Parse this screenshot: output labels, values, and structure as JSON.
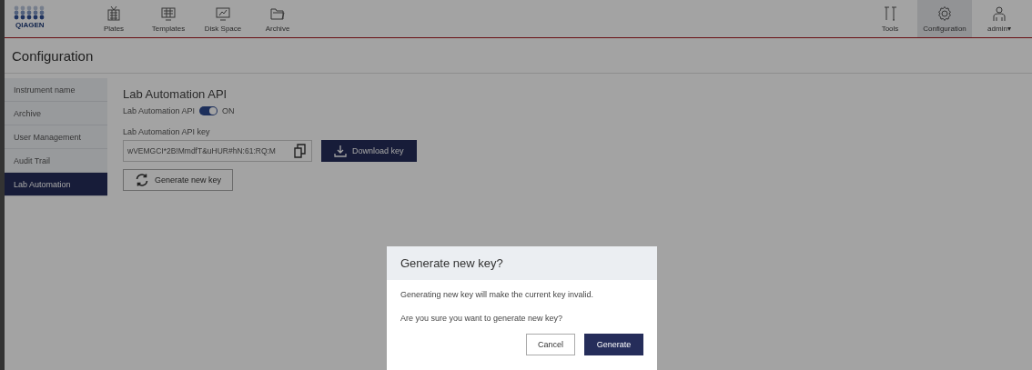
{
  "logo": {
    "text": "QIAGEN"
  },
  "nav": {
    "items": [
      {
        "label": "Plates",
        "selected": false
      },
      {
        "label": "Templates",
        "selected": false
      },
      {
        "label": "Disk Space",
        "selected": false
      },
      {
        "label": "Archive",
        "selected": false
      }
    ],
    "right_items": [
      {
        "label": "Tools",
        "selected": false
      },
      {
        "label": "Configuration",
        "selected": true
      },
      {
        "label": "admin",
        "selected": false,
        "caret": "▾"
      }
    ]
  },
  "page_title": "Configuration",
  "sidebar": {
    "items": [
      {
        "label": "Instrument name",
        "selected": false
      },
      {
        "label": "Archive",
        "selected": false
      },
      {
        "label": "User Management",
        "selected": false
      },
      {
        "label": "Audit Trail",
        "selected": false
      },
      {
        "label": "Lab Automation",
        "selected": true
      }
    ]
  },
  "section": {
    "title": "Lab Automation API",
    "toggle": {
      "label": "Lab Automation API",
      "on": true,
      "state_text": "ON"
    },
    "key_label": "Lab Automation API key",
    "key_value": "wVEMGCI*2B!MmdfT&uHUR#hN:61:RQ:M",
    "download_button": "Download key",
    "generate_button": "Generate new key"
  },
  "dialog": {
    "title": "Generate new key?",
    "messages": [
      "Generating new key will make the current key invalid.",
      "Are you sure you want to generate new key?"
    ],
    "cancel_button": "Cancel",
    "confirm_button": "Generate"
  }
}
